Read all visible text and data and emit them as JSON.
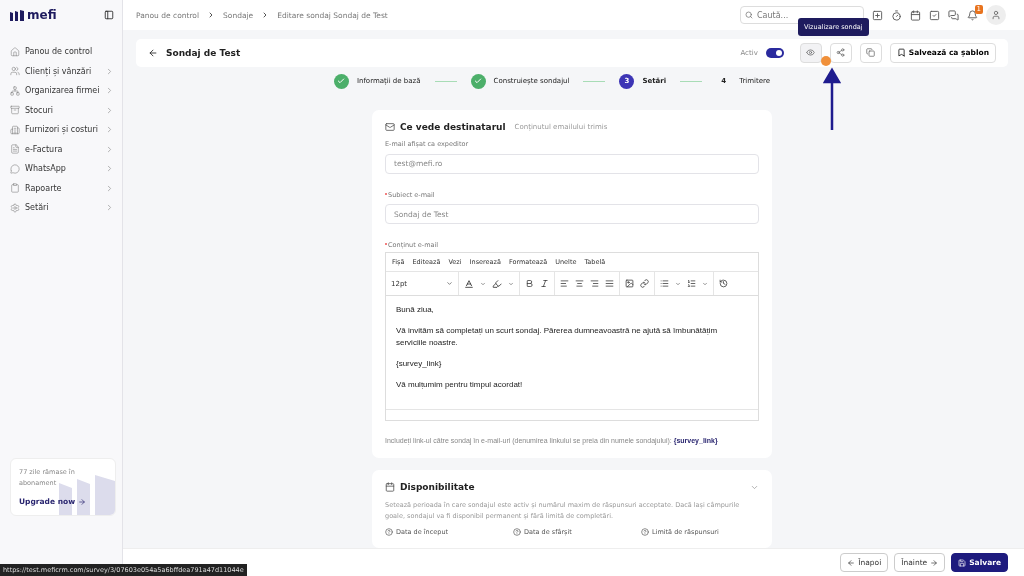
{
  "sidebar": {
    "logo": "mefi",
    "items": [
      {
        "label": "Panou de control",
        "has_submenu": false
      },
      {
        "label": "Clienți și vânzări",
        "has_submenu": true
      },
      {
        "label": "Organizarea firmei",
        "has_submenu": true
      },
      {
        "label": "Stocuri",
        "has_submenu": true
      },
      {
        "label": "Furnizori și costuri",
        "has_submenu": true
      },
      {
        "label": "e-Factura",
        "has_submenu": true
      },
      {
        "label": "WhatsApp",
        "has_submenu": true
      },
      {
        "label": "Rapoarte",
        "has_submenu": true
      },
      {
        "label": "Setări",
        "has_submenu": true
      }
    ],
    "trial": {
      "text": "77 zile rămase în abonament",
      "link": "Upgrade now"
    }
  },
  "header": {
    "breadcrumbs": [
      "Panou de control",
      "Sondaje",
      "Editare sondaj Sondaj de Test"
    ],
    "search": {
      "placeholder": "Caută..."
    },
    "notification_count": "1"
  },
  "survey_bar": {
    "title": "Sondaj de Test",
    "active_label": "Activ",
    "active": true,
    "tooltip": "Vizualizare sondaj",
    "save_template": "Salvează ca șablon"
  },
  "steps": [
    {
      "label": "Informații de bază",
      "done": true,
      "selected": false
    },
    {
      "label": "Construiește sondajul",
      "done": true,
      "selected": false
    },
    {
      "number": "3",
      "label": "Setări",
      "done": false,
      "selected": true
    },
    {
      "number": "4",
      "label": "Trimitere",
      "done": false,
      "selected": false
    }
  ],
  "email_card": {
    "title": "Ce vede destinatarul",
    "subtitle": "Conținutul emailului trimis",
    "fields": [
      {
        "label": "E-mail afișat ca expeditor",
        "required": false,
        "placeholder": "test@mefi.ro"
      },
      {
        "label": "Subiect e-mail",
        "required": true,
        "placeholder": "Sondaj de Test"
      }
    ],
    "editor": {
      "label": "Conținut e-mail",
      "required": true,
      "menu": [
        "Fișă",
        "Editează",
        "Vezi",
        "Inserează",
        "Formatează",
        "Unelte",
        "Tabelă"
      ],
      "font_size": "12pt",
      "paragraphs": [
        "Bună ziua,",
        "Vă invităm să completați un scurt sondaj. Părerea dumneavoastră ne ajută să îmbunătățim serviciile noastre.",
        "{survey_link}",
        "Vă mulțumim pentru timpul acordat!"
      ]
    },
    "hint": "Includeți link-ul către sondaj în e-mail-uri (denumirea linkului se preia din numele sondajului): **{survey_link}**"
  },
  "availability_card": {
    "title": "Disponibilitate",
    "expanded": true,
    "description": "Setează perioada în care sondajul este activ și numărul maxim de răspunsuri acceptate. Dacă lași câmpurile goale, sondajul va fi disponibil permanent și fără limită de completări.",
    "fields": [
      "Data de început",
      "Data de sfârșit",
      "Limită de răspunsuri"
    ]
  },
  "footer": [
    {
      "label": "Înapoi",
      "kind": "back"
    },
    {
      "label": "Înainte",
      "kind": "next"
    },
    {
      "label": "Salvare",
      "kind": "save"
    }
  ],
  "status_url": "https://test.meficrm.com/survey/3/07603e054a5a6bffdea791a47d11044e"
}
